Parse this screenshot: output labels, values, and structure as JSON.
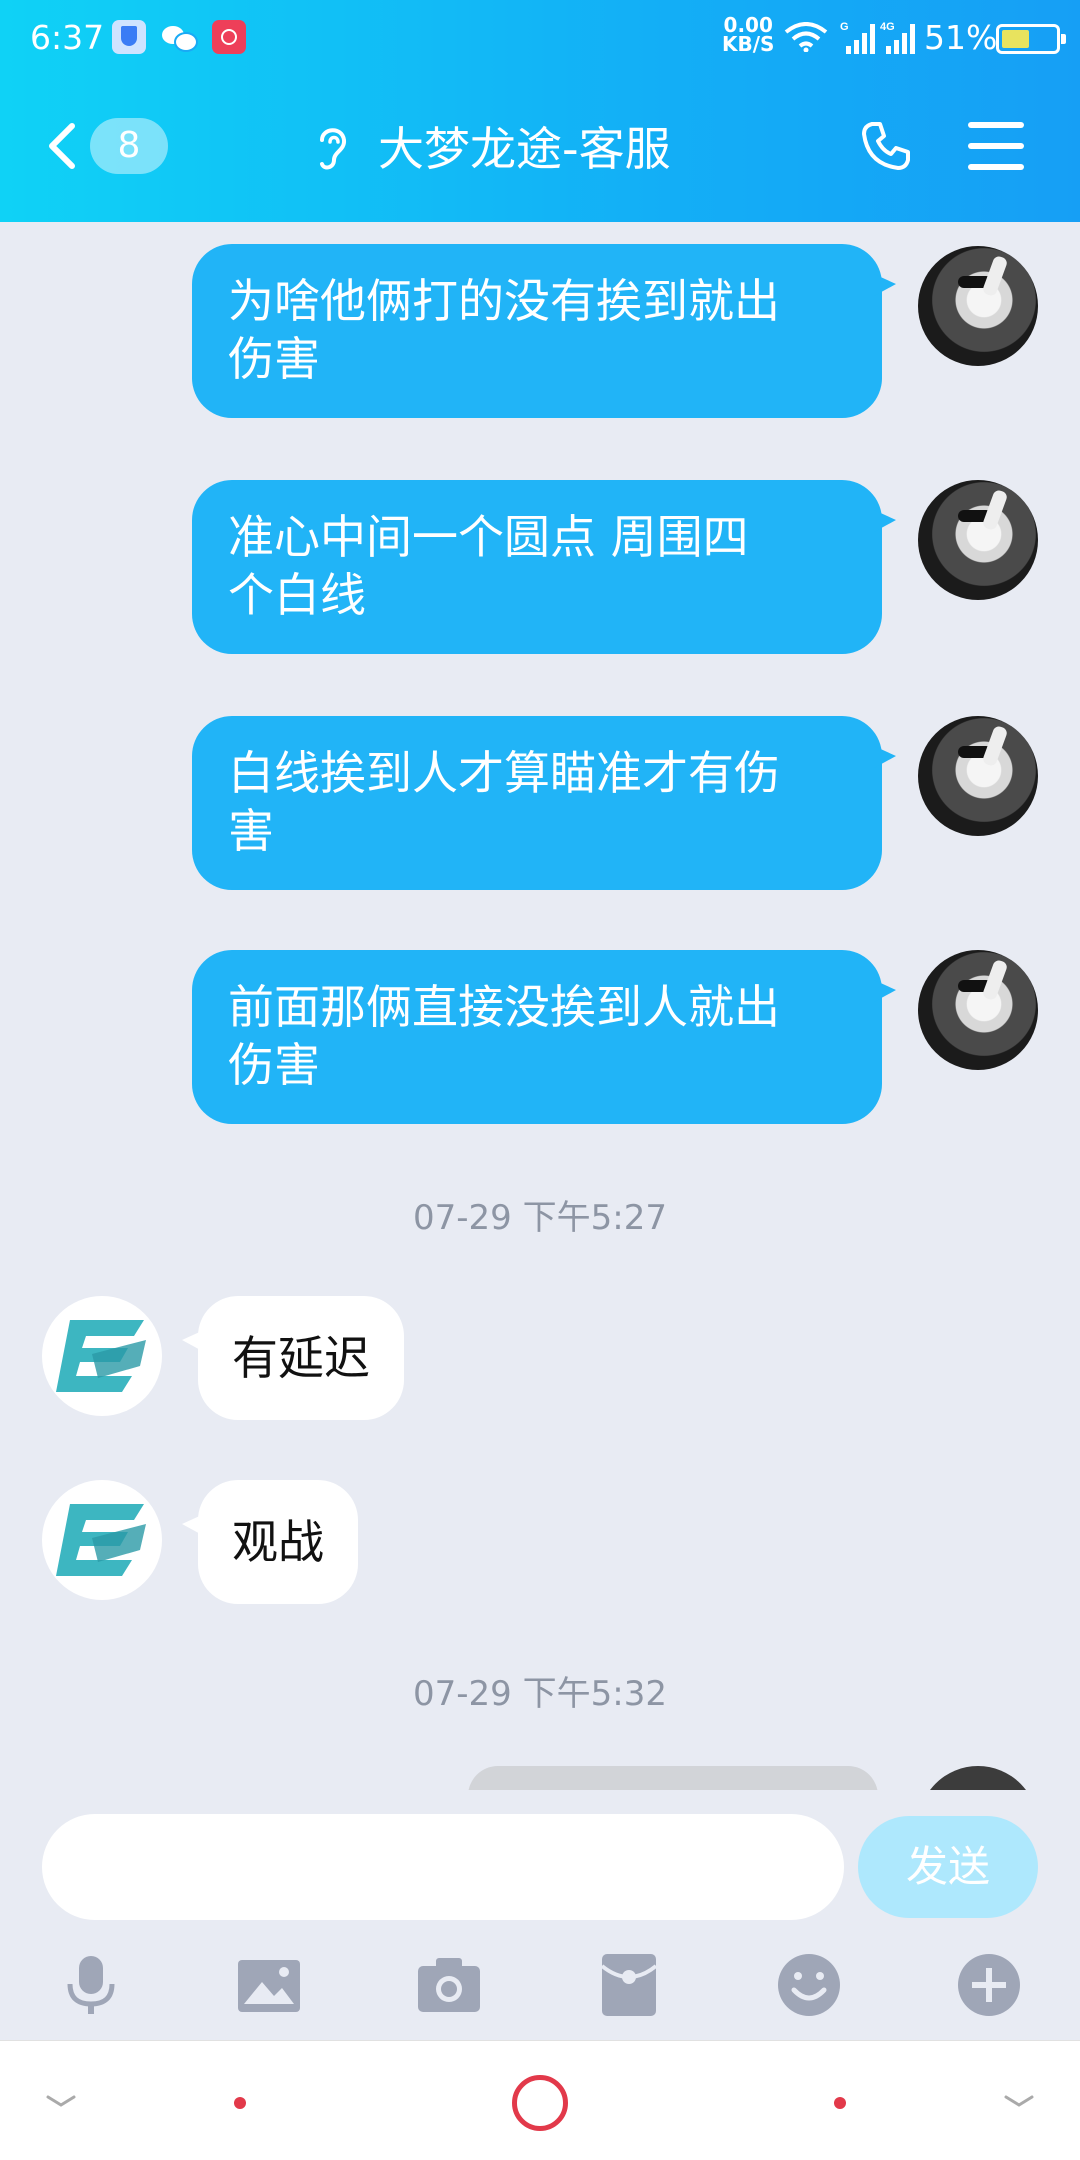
{
  "status_bar": {
    "time": "6:37",
    "net_speed_value": "0.00",
    "net_speed_unit": "KB/S",
    "signal_1_label": "G",
    "signal_2_label": "4G",
    "battery_percent": "51%",
    "battery_level": 0.51
  },
  "header": {
    "unread_count": "8",
    "title": "大梦龙途-客服"
  },
  "messages": [
    {
      "direction": "out",
      "line1": "为啥他俩打的没有挨到就出",
      "line2": "伤害"
    },
    {
      "direction": "out",
      "line1": "准心中间一个圆点  周围四",
      "line2": "个白线"
    },
    {
      "direction": "out",
      "line1": "白线挨到人才算瞄准才有伤",
      "line2": "害"
    },
    {
      "direction": "out",
      "line1": "前面那俩直接没挨到人就出",
      "line2": "伤害"
    },
    {
      "timestamp": "07-29 下午5:27"
    },
    {
      "direction": "in",
      "text": "有延迟"
    },
    {
      "direction": "in",
      "text": "观战"
    },
    {
      "timestamp": "07-29 下午5:32"
    }
  ],
  "input": {
    "value": "",
    "send_label": "发送"
  },
  "toolbar": [
    "microphone-icon",
    "image-icon",
    "camera-icon",
    "red-packet-icon",
    "emoji-icon",
    "plus-icon"
  ],
  "colors": {
    "header_start": "#0fd2f6",
    "header_end": "#169ff5",
    "outgoing_bubble": "#21b4f7",
    "incoming_bubble": "#ffffff",
    "chat_background": "#e8ebf3",
    "send_button": "#aee8fd",
    "nav_accent": "#e2394a",
    "toolbar_icon": "#9fa6b7"
  }
}
